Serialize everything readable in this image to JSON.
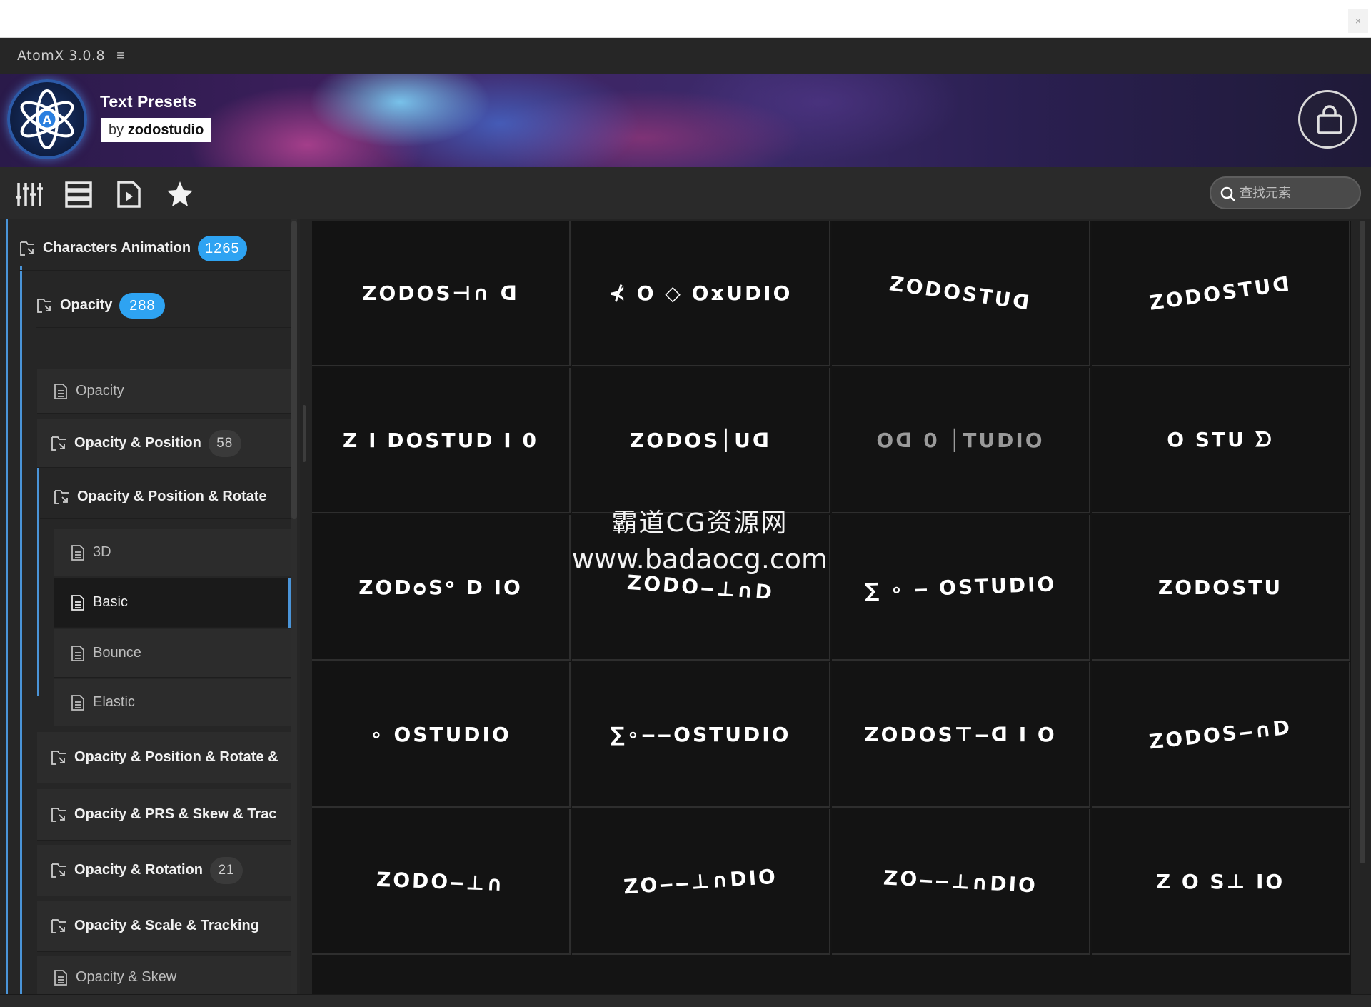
{
  "window": {
    "close_label": "×"
  },
  "app": {
    "name": "AtomX 3.0.8",
    "menu_glyph": "≡"
  },
  "banner": {
    "title": "Text Presets",
    "by_prefix": "by ",
    "by_name": "zodostudio"
  },
  "toolbar": {
    "tools": [
      "sliders-icon",
      "list-icon",
      "media-icon",
      "star-icon"
    ],
    "search_placeholder": "查找元素"
  },
  "sidebar": {
    "items": [
      {
        "label": "Characters Animation",
        "count": "1265",
        "kind": "folder",
        "badge": "blue"
      },
      {
        "label": "Opacity",
        "count": "288",
        "kind": "folder",
        "badge": "blue"
      },
      {
        "label": "Opacity",
        "count": "",
        "kind": "file"
      },
      {
        "label": "Opacity & Position",
        "count": "58",
        "kind": "folder",
        "badge": "gray"
      },
      {
        "label": "Opacity & Position & Rotate",
        "count": "",
        "kind": "folder"
      },
      {
        "label": "3D",
        "count": "",
        "kind": "file"
      },
      {
        "label": "Basic",
        "count": "",
        "kind": "file",
        "selected": true
      },
      {
        "label": "Bounce",
        "count": "",
        "kind": "file"
      },
      {
        "label": "Elastic",
        "count": "",
        "kind": "file"
      },
      {
        "label": "Opacity & Position & Rotate &",
        "count": "",
        "kind": "folder"
      },
      {
        "label": "Opacity & PRS & Skew & Trac",
        "count": "",
        "kind": "folder"
      },
      {
        "label": "Opacity & Rotation",
        "count": "21",
        "kind": "folder",
        "badge": "gray"
      },
      {
        "label": "Opacity & Scale & Tracking",
        "count": "",
        "kind": "folder"
      },
      {
        "label": "Opacity & Skew",
        "count": "",
        "kind": "file"
      }
    ]
  },
  "presets": [
    "ZODOS⊣∩ ᗡ",
    "⊀ O ◇ OϫUDIO",
    "ZODOSTUᗡ",
    "ZODOSTUᗡ",
    "Z  I DOSTUD I  0",
    "ZODOS│Uᗡ",
    "Oᗡ 0 │TUDIO",
    "O  STU ᗤ",
    "ZODᴑSᵒ D IO",
    "ZODO‒⊥∩D",
    "∑ ∘ ‒ OSTUDIO",
    "ZODOSTU",
    "  ∘ OSTUDIO",
    "∑∘‒‒OSTUDIO",
    "ZODOS⊤‒ᗡ I O",
    "ZODOS‒∩D",
    "ZODO‒⊥∩",
    "ZO‒‒⊥∩DIO",
    "ZO‒‒⊥∩DIO",
    "Z  O S⊥  IO"
  ],
  "watermark": {
    "line1": "霸道CG资源网",
    "line2": "www.badaocg.com"
  },
  "statusbar": {
    "left_icons": [
      "target-icon",
      "video-icon",
      "music-icon"
    ],
    "right_icons": [
      "expand-icon",
      "fit-icon",
      "fullscreen-icon"
    ],
    "zoom_fraction": 0.35
  },
  "colors": {
    "accent": "#2ea3f2",
    "tree_line": "#4a94d8",
    "bg": "#242424"
  }
}
